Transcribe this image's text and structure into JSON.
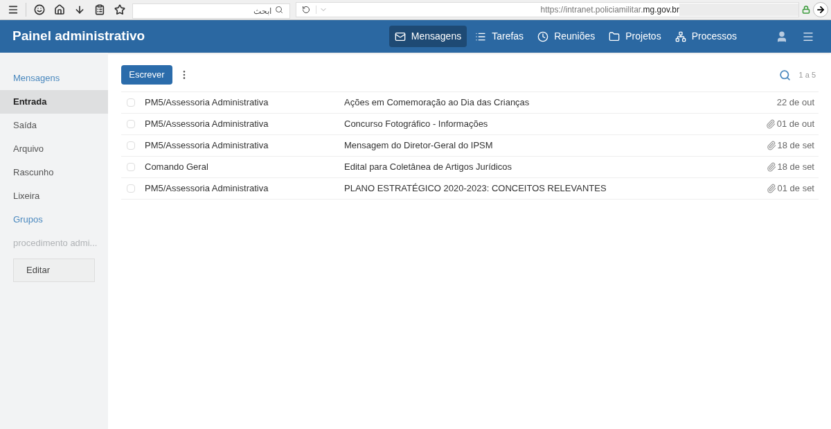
{
  "browser": {
    "search": {
      "placeholder": "ابحث"
    },
    "url": {
      "host": "https://intranet.policiamilitar.",
      "domain": "mg.gov.br"
    }
  },
  "header": {
    "title": "Painel administrativo",
    "nav": [
      {
        "label": "Mensagens",
        "selected": true
      },
      {
        "label": "Tarefas",
        "selected": false
      },
      {
        "label": "Reuniões",
        "selected": false
      },
      {
        "label": "Projetos",
        "selected": false
      },
      {
        "label": "Processos",
        "selected": false
      }
    ]
  },
  "sidebar": {
    "items": [
      {
        "kind": "heading",
        "label": "Mensagens"
      },
      {
        "kind": "folder",
        "label": "Entrada",
        "selected": true
      },
      {
        "kind": "folder",
        "label": "Saída",
        "selected": false
      },
      {
        "kind": "folder",
        "label": "Arquivo",
        "selected": false
      },
      {
        "kind": "folder",
        "label": "Rascunho",
        "selected": false
      },
      {
        "kind": "folder",
        "label": "Lixeira",
        "selected": false
      },
      {
        "kind": "heading",
        "label": "Grupos"
      },
      {
        "kind": "group",
        "label": "procedimento admi..."
      }
    ],
    "edit_button": "Editar"
  },
  "toolbar": {
    "compose": "Escrever",
    "range": "1 a 5"
  },
  "messages": [
    {
      "checked": false,
      "sender": "PM5/Assessoria Administrativa",
      "subject": "Ações em Comemoração ao Dia das Crianças",
      "attachment": false,
      "date": "22 de out"
    },
    {
      "checked": false,
      "sender": "PM5/Assessoria Administrativa",
      "subject": "Concurso Fotográfico - Informações",
      "attachment": true,
      "date": "01 de out"
    },
    {
      "checked": false,
      "sender": "PM5/Assessoria Administrativa",
      "subject": "Mensagem do Diretor-Geral do IPSM",
      "attachment": true,
      "date": "18 de set"
    },
    {
      "checked": false,
      "sender": "Comando Geral",
      "subject": "Edital para Coletânea de Artigos Jurídicos",
      "attachment": true,
      "date": "18 de set"
    },
    {
      "checked": false,
      "sender": "PM5/Assessoria Administrativa",
      "subject": "PLANO ESTRATÉGICO 2020-2023: CONCEITOS RELEVANTES",
      "attachment": true,
      "date": "01 de set"
    }
  ]
}
